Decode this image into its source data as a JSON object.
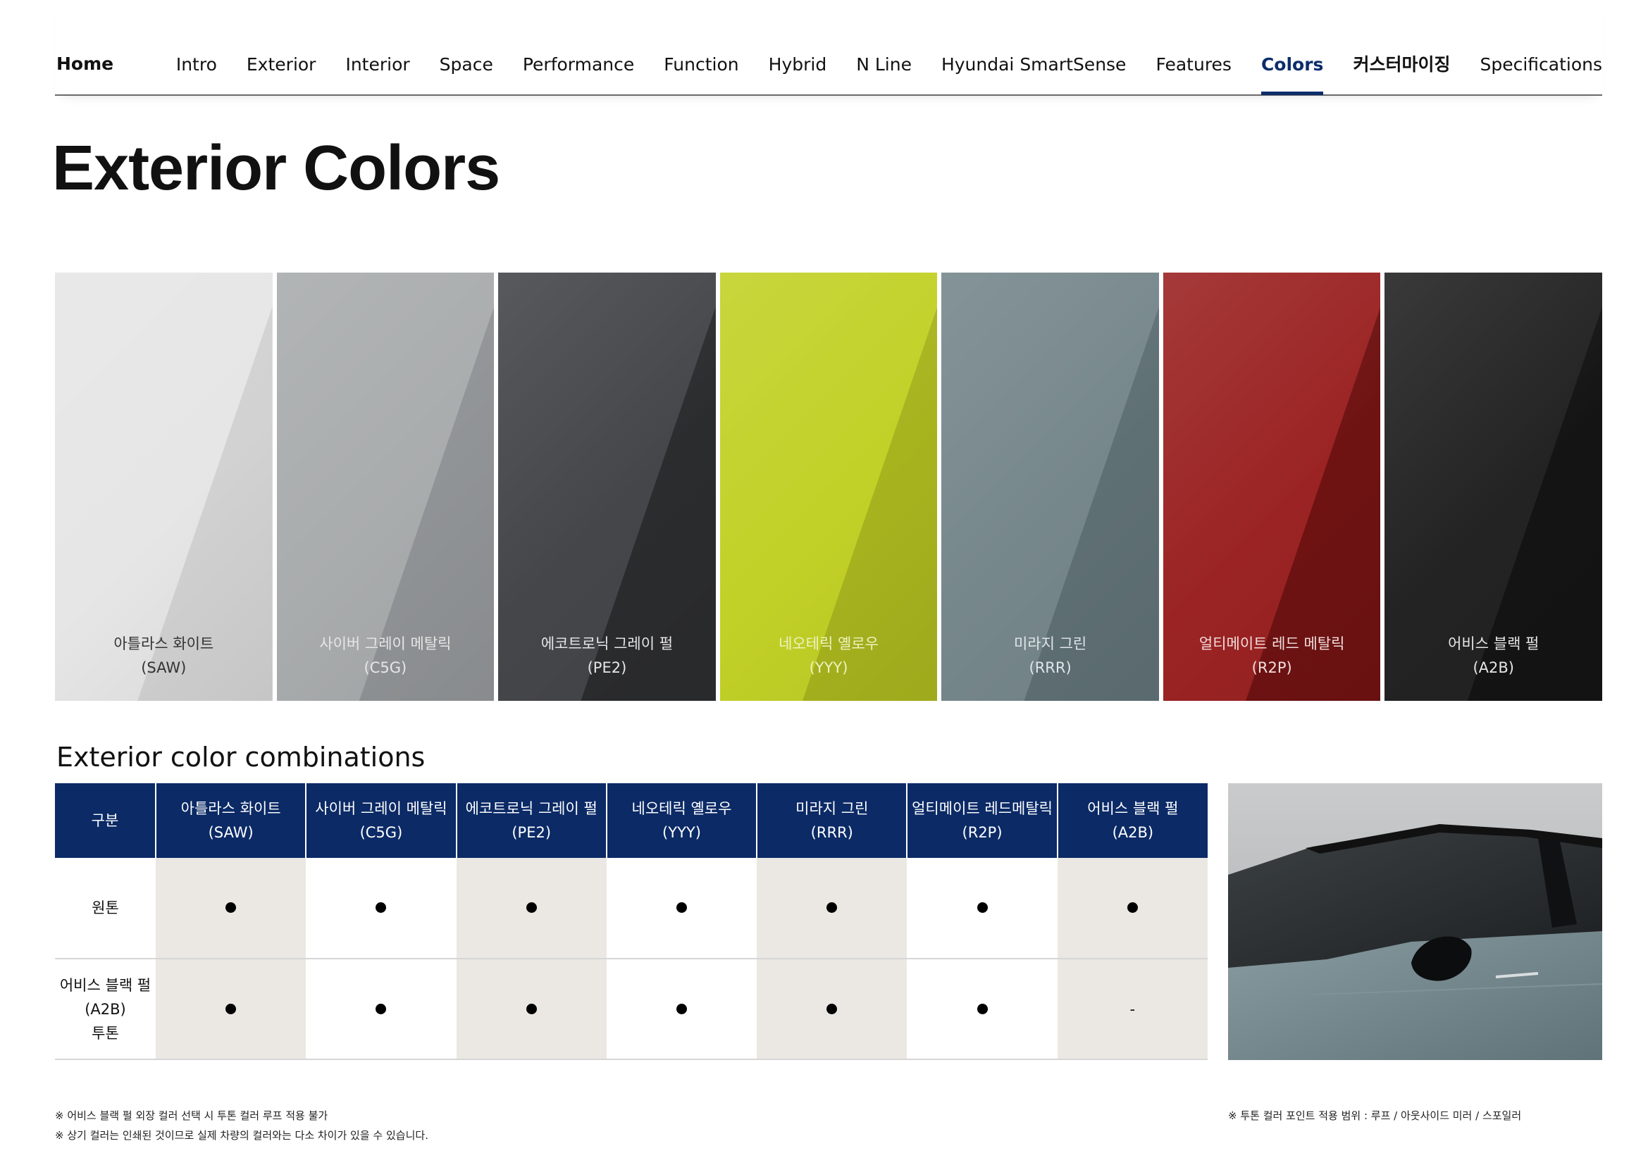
{
  "nav": {
    "home": "Home",
    "items": [
      "Intro",
      "Exterior",
      "Interior",
      "Space",
      "Performance",
      "Function",
      "Hybrid",
      "N Line",
      "Hyundai SmartSense",
      "Features",
      "Colors",
      "커스터마이징",
      "Specifications"
    ],
    "active": "Colors"
  },
  "page_title": "Exterior Colors",
  "swatches": [
    {
      "name": "아틀라스 화이트",
      "code": "(SAW)",
      "base": "#e6e6e6",
      "shade": "#d2d2d2",
      "text": "#333333"
    },
    {
      "name": "사이버 그레이 메탈릭",
      "code": "(C5G)",
      "base": "#a9acad",
      "shade": "#919496",
      "text": "#e6e6e6"
    },
    {
      "name": "에코트로닉 그레이 펄",
      "code": "(PE2)",
      "base": "#45464a",
      "shade": "#2b2c2e",
      "text": "#e6e6e6"
    },
    {
      "name": "네오테릭 옐로우",
      "code": "(YYY)",
      "base": "#c2d127",
      "shade": "#a8b41e",
      "text": "#eef2c0"
    },
    {
      "name": "미라지 그린",
      "code": "(RRR)",
      "base": "#76878c",
      "shade": "#5f7075",
      "text": "#e0e6e8"
    },
    {
      "name": "얼티메이트 레드 메탈릭",
      "code": "(R2P)",
      "base": "#9b2323",
      "shade": "#6f1212",
      "text": "#f2dede"
    },
    {
      "name": "어비스 블랙 펄",
      "code": "(A2B)",
      "base": "#232323",
      "shade": "#141414",
      "text": "#e6e6e6"
    }
  ],
  "combinations": {
    "title": "Exterior color combinations",
    "header_label": "구분",
    "columns": [
      {
        "name": "아틀라스 화이트",
        "code": "(SAW)"
      },
      {
        "name": "사이버 그레이 메탈릭",
        "code": "(C5G)"
      },
      {
        "name": "에코트로닉 그레이 펄",
        "code": "(PE2)"
      },
      {
        "name": "네오테릭 옐로우",
        "code": "(YYY)"
      },
      {
        "name": "미라지 그린",
        "code": "(RRR)"
      },
      {
        "name": "얼티메이트 레드메탈릭",
        "code": "(R2P)"
      },
      {
        "name": "어비스 블랙 펄",
        "code": "(A2B)"
      }
    ],
    "rows": [
      {
        "label_lines": [
          "원톤"
        ],
        "values": [
          "●",
          "●",
          "●",
          "●",
          "●",
          "●",
          "●"
        ]
      },
      {
        "label_lines": [
          "어비스 블랙 펄",
          "(A2B)",
          "투톤"
        ],
        "values": [
          "●",
          "●",
          "●",
          "●",
          "●",
          "●",
          "-"
        ]
      }
    ]
  },
  "notes": {
    "left_1": "※ 어비스 블랙 펄 외장 컬러 선택 시 투톤 컬러 루프 적용 불가",
    "left_2": "※ 상기 컬러는 인쇄된 것이므로 실제 차량의 컬러와는 다소 차이가 있을 수 있습니다.",
    "right": "※ 투톤 컬러 포인트 적용 범위 : 루프 / 아웃사이드 미러 / 스포일러"
  },
  "colors": {
    "nav_active": "#0c2d6b",
    "table_header": "#0b2a66",
    "table_shade": "#ebe8e4"
  }
}
